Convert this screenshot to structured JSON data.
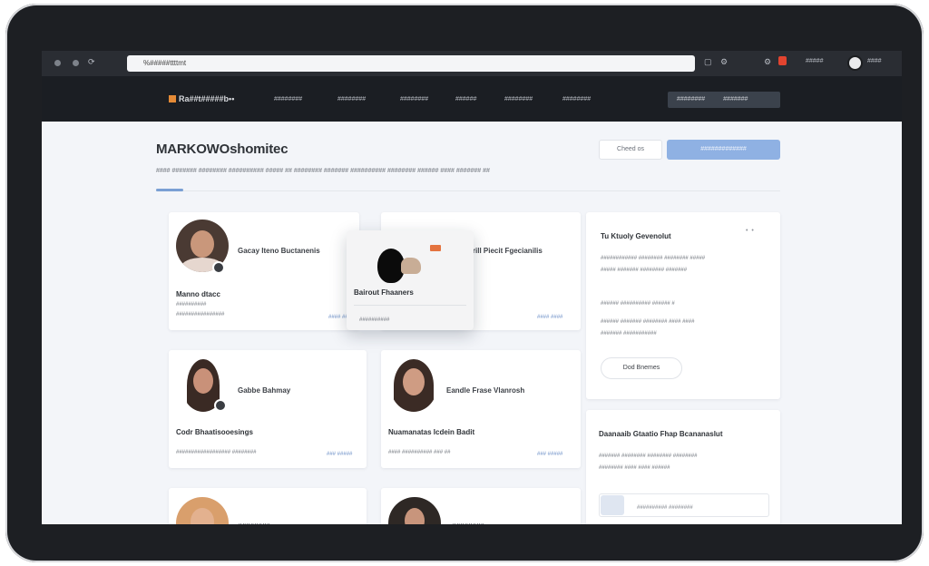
{
  "browser": {
    "url": "%#####ttttmt",
    "user_label": "#####",
    "user2_label": "####"
  },
  "nav": {
    "brand": "Ra##t#####b••",
    "links": [
      "########",
      "########",
      "########",
      "######",
      "########",
      "########"
    ],
    "pill": [
      "########",
      "#######"
    ]
  },
  "header": {
    "title": "MARKOWOshomitec",
    "subtitle": "#### ####### ######## ########## ##### ## ######## ####### ########## ######## ###### #### ####### ##",
    "ghost_button": "Cheed os",
    "primary_button": "#############"
  },
  "cards": [
    {
      "name": "Gacay Iteno Buctanenis",
      "role": "Manno dtacc",
      "meta": [
        "##########",
        "################"
      ],
      "link": "#### ####"
    },
    {
      "name": "Frill Piecit Fgecianilis",
      "link": "#### ####"
    },
    {
      "name": "Gabbe Bahmay",
      "role": "Codr Bhaatisooesings",
      "meta": [
        "################## ########",
        "## ####"
      ],
      "link": "### #####"
    },
    {
      "name": "Eandle Frase Vlanrosh",
      "role": "Nuamanatas Icdein Badit",
      "meta": [
        "#### ########## ### ##"
      ],
      "link": "### #####"
    },
    {
      "name": "########"
    },
    {
      "name": "########"
    }
  ],
  "popup": {
    "title": "Bairout Fhaaners",
    "subtitle": "##########"
  },
  "panel_top": {
    "title": "Tu Ktuoly Gevenolut",
    "lines": [
      "############ ######## ######## #####",
      "##### ####### ######## #######",
      "###### ########## ###### #",
      "###### ####### ######## #### ####",
      "####### ###########"
    ],
    "button": "Dod Bnemes"
  },
  "panel_bottom": {
    "title": "Daanaaib Gtaatio Fhap Bcananaslut",
    "lines": [
      "####### ######## ######## ########",
      "######## #### #### ######"
    ],
    "input_text": "########## ########"
  }
}
